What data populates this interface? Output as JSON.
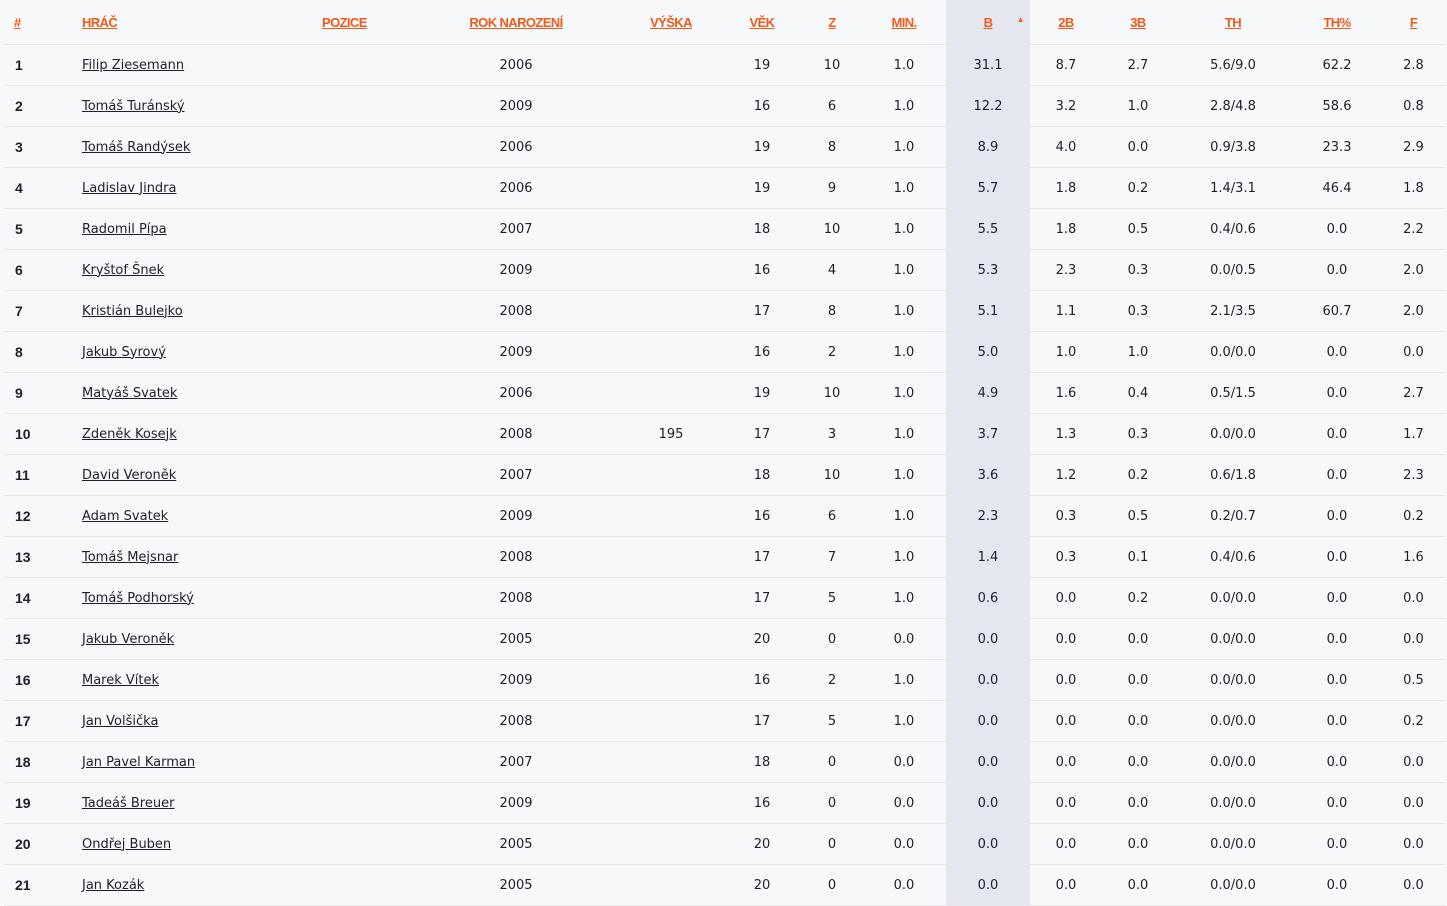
{
  "columns": [
    {
      "key": "rank",
      "label": "#"
    },
    {
      "key": "player",
      "label": "Hráč"
    },
    {
      "key": "position",
      "label": "Pozice"
    },
    {
      "key": "birth_year",
      "label": "Rok narození"
    },
    {
      "key": "height",
      "label": "Výška"
    },
    {
      "key": "age",
      "label": "Věk"
    },
    {
      "key": "games",
      "label": "Z"
    },
    {
      "key": "minutes",
      "label": "Min."
    },
    {
      "key": "points",
      "label": "B"
    },
    {
      "key": "two_pt",
      "label": "2B"
    },
    {
      "key": "three_pt",
      "label": "3B"
    },
    {
      "key": "ft",
      "label": "TH"
    },
    {
      "key": "ft_pct",
      "label": "TH%"
    },
    {
      "key": "fouls",
      "label": "F"
    }
  ],
  "sort": {
    "column": "points",
    "icon": "sort-desc-icon",
    "glyph": "▲"
  },
  "colors": {
    "accent": "#f05a1a",
    "highlight_column": "#e4e7ef",
    "row_border": "#e6e8ee"
  },
  "rows": [
    {
      "rank": "1",
      "player": "Filip Ziesemann",
      "position": "",
      "birth_year": "2006",
      "height": "",
      "age": "19",
      "games": "10",
      "minutes": "1.0",
      "points": "31.1",
      "two_pt": "8.7",
      "three_pt": "2.7",
      "ft": "5.6/9.0",
      "ft_pct": "62.2",
      "fouls": "2.8"
    },
    {
      "rank": "2",
      "player": "Tomáš Turánský",
      "position": "",
      "birth_year": "2009",
      "height": "",
      "age": "16",
      "games": "6",
      "minutes": "1.0",
      "points": "12.2",
      "two_pt": "3.2",
      "three_pt": "1.0",
      "ft": "2.8/4.8",
      "ft_pct": "58.6",
      "fouls": "0.8"
    },
    {
      "rank": "3",
      "player": "Tomáš Randýsek",
      "position": "",
      "birth_year": "2006",
      "height": "",
      "age": "19",
      "games": "8",
      "minutes": "1.0",
      "points": "8.9",
      "two_pt": "4.0",
      "three_pt": "0.0",
      "ft": "0.9/3.8",
      "ft_pct": "23.3",
      "fouls": "2.9"
    },
    {
      "rank": "4",
      "player": "Ladislav Jindra",
      "position": "",
      "birth_year": "2006",
      "height": "",
      "age": "19",
      "games": "9",
      "minutes": "1.0",
      "points": "5.7",
      "two_pt": "1.8",
      "three_pt": "0.2",
      "ft": "1.4/3.1",
      "ft_pct": "46.4",
      "fouls": "1.8"
    },
    {
      "rank": "5",
      "player": "Radomil Pípa",
      "position": "",
      "birth_year": "2007",
      "height": "",
      "age": "18",
      "games": "10",
      "minutes": "1.0",
      "points": "5.5",
      "two_pt": "1.8",
      "three_pt": "0.5",
      "ft": "0.4/0.6",
      "ft_pct": "0.0",
      "fouls": "2.2"
    },
    {
      "rank": "6",
      "player": "Kryštof Šnek",
      "position": "",
      "birth_year": "2009",
      "height": "",
      "age": "16",
      "games": "4",
      "minutes": "1.0",
      "points": "5.3",
      "two_pt": "2.3",
      "three_pt": "0.3",
      "ft": "0.0/0.5",
      "ft_pct": "0.0",
      "fouls": "2.0"
    },
    {
      "rank": "7",
      "player": "Kristián Bulejko",
      "position": "",
      "birth_year": "2008",
      "height": "",
      "age": "17",
      "games": "8",
      "minutes": "1.0",
      "points": "5.1",
      "two_pt": "1.1",
      "three_pt": "0.3",
      "ft": "2.1/3.5",
      "ft_pct": "60.7",
      "fouls": "2.0"
    },
    {
      "rank": "8",
      "player": "Jakub Syrový",
      "position": "",
      "birth_year": "2009",
      "height": "",
      "age": "16",
      "games": "2",
      "minutes": "1.0",
      "points": "5.0",
      "two_pt": "1.0",
      "three_pt": "1.0",
      "ft": "0.0/0.0",
      "ft_pct": "0.0",
      "fouls": "0.0"
    },
    {
      "rank": "9",
      "player": "Matyáš Svatek",
      "position": "",
      "birth_year": "2006",
      "height": "",
      "age": "19",
      "games": "10",
      "minutes": "1.0",
      "points": "4.9",
      "two_pt": "1.6",
      "three_pt": "0.4",
      "ft": "0.5/1.5",
      "ft_pct": "0.0",
      "fouls": "2.7"
    },
    {
      "rank": "10",
      "player": "Zdeněk Kosejk",
      "position": "",
      "birth_year": "2008",
      "height": "195",
      "age": "17",
      "games": "3",
      "minutes": "1.0",
      "points": "3.7",
      "two_pt": "1.3",
      "three_pt": "0.3",
      "ft": "0.0/0.0",
      "ft_pct": "0.0",
      "fouls": "1.7"
    },
    {
      "rank": "11",
      "player": "David Veroněk",
      "position": "",
      "birth_year": "2007",
      "height": "",
      "age": "18",
      "games": "10",
      "minutes": "1.0",
      "points": "3.6",
      "two_pt": "1.2",
      "three_pt": "0.2",
      "ft": "0.6/1.8",
      "ft_pct": "0.0",
      "fouls": "2.3"
    },
    {
      "rank": "12",
      "player": "Adam Svatek",
      "position": "",
      "birth_year": "2009",
      "height": "",
      "age": "16",
      "games": "6",
      "minutes": "1.0",
      "points": "2.3",
      "two_pt": "0.3",
      "three_pt": "0.5",
      "ft": "0.2/0.7",
      "ft_pct": "0.0",
      "fouls": "0.2"
    },
    {
      "rank": "13",
      "player": "Tomáš Mejsnar",
      "position": "",
      "birth_year": "2008",
      "height": "",
      "age": "17",
      "games": "7",
      "minutes": "1.0",
      "points": "1.4",
      "two_pt": "0.3",
      "three_pt": "0.1",
      "ft": "0.4/0.6",
      "ft_pct": "0.0",
      "fouls": "1.6"
    },
    {
      "rank": "14",
      "player": "Tomáš Podhorský",
      "position": "",
      "birth_year": "2008",
      "height": "",
      "age": "17",
      "games": "5",
      "minutes": "1.0",
      "points": "0.6",
      "two_pt": "0.0",
      "three_pt": "0.2",
      "ft": "0.0/0.0",
      "ft_pct": "0.0",
      "fouls": "0.0"
    },
    {
      "rank": "15",
      "player": "Jakub Veroněk",
      "position": "",
      "birth_year": "2005",
      "height": "",
      "age": "20",
      "games": "0",
      "minutes": "0.0",
      "points": "0.0",
      "two_pt": "0.0",
      "three_pt": "0.0",
      "ft": "0.0/0.0",
      "ft_pct": "0.0",
      "fouls": "0.0"
    },
    {
      "rank": "16",
      "player": "Marek Vítek",
      "position": "",
      "birth_year": "2009",
      "height": "",
      "age": "16",
      "games": "2",
      "minutes": "1.0",
      "points": "0.0",
      "two_pt": "0.0",
      "three_pt": "0.0",
      "ft": "0.0/0.0",
      "ft_pct": "0.0",
      "fouls": "0.5"
    },
    {
      "rank": "17",
      "player": "Jan Volšička",
      "position": "",
      "birth_year": "2008",
      "height": "",
      "age": "17",
      "games": "5",
      "minutes": "1.0",
      "points": "0.0",
      "two_pt": "0.0",
      "three_pt": "0.0",
      "ft": "0.0/0.0",
      "ft_pct": "0.0",
      "fouls": "0.2"
    },
    {
      "rank": "18",
      "player": "Jan Pavel Karman",
      "position": "",
      "birth_year": "2007",
      "height": "",
      "age": "18",
      "games": "0",
      "minutes": "0.0",
      "points": "0.0",
      "two_pt": "0.0",
      "three_pt": "0.0",
      "ft": "0.0/0.0",
      "ft_pct": "0.0",
      "fouls": "0.0"
    },
    {
      "rank": "19",
      "player": "Tadeáš Breuer",
      "position": "",
      "birth_year": "2009",
      "height": "",
      "age": "16",
      "games": "0",
      "minutes": "0.0",
      "points": "0.0",
      "two_pt": "0.0",
      "three_pt": "0.0",
      "ft": "0.0/0.0",
      "ft_pct": "0.0",
      "fouls": "0.0"
    },
    {
      "rank": "20",
      "player": "Ondřej Buben",
      "position": "",
      "birth_year": "2005",
      "height": "",
      "age": "20",
      "games": "0",
      "minutes": "0.0",
      "points": "0.0",
      "two_pt": "0.0",
      "three_pt": "0.0",
      "ft": "0.0/0.0",
      "ft_pct": "0.0",
      "fouls": "0.0"
    },
    {
      "rank": "21",
      "player": "Jan Kozák",
      "position": "",
      "birth_year": "2005",
      "height": "",
      "age": "20",
      "games": "0",
      "minutes": "0.0",
      "points": "0.0",
      "two_pt": "0.0",
      "three_pt": "0.0",
      "ft": "0.0/0.0",
      "ft_pct": "0.0",
      "fouls": "0.0"
    }
  ]
}
